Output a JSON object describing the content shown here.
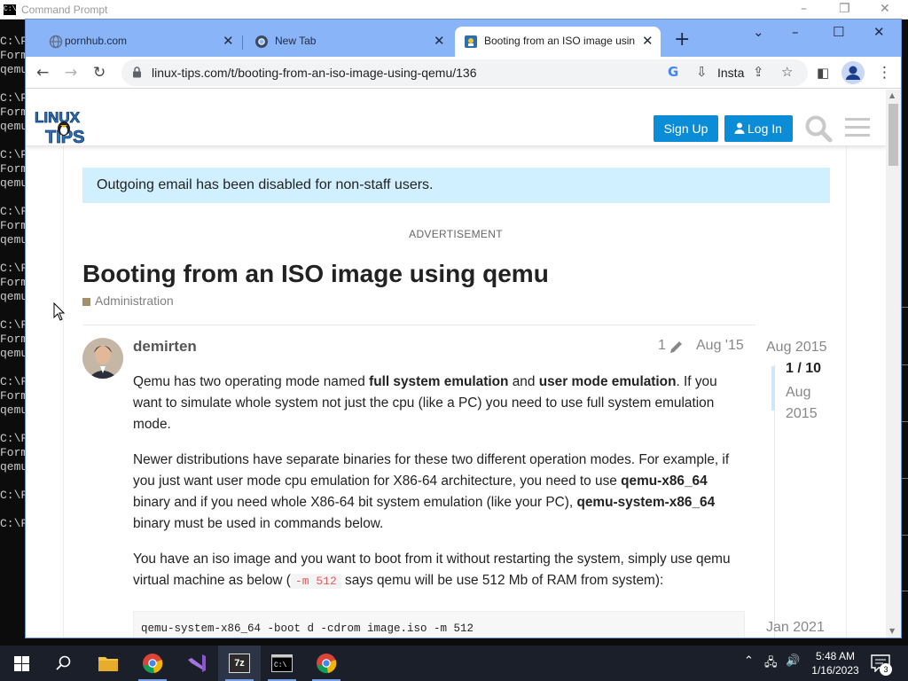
{
  "cmd": {
    "title": "Command Prompt",
    "lines": [
      "C:\\P",
      "Form",
      "qemu",
      "",
      "C:\\P",
      "Form",
      "qemu",
      "",
      "C:\\P",
      "Form",
      "qemu",
      "",
      "C:\\F",
      "Form",
      "qemu",
      "",
      "C:\\F",
      "Form",
      "qemu",
      "",
      "C:\\F",
      "Form",
      "qemu",
      "",
      "C:\\F",
      "Form",
      "qemu",
      "",
      "C:\\F",
      "Form",
      "qemu",
      "",
      "C:\\F",
      "",
      "C:\\F"
    ]
  },
  "browser": {
    "tabs": [
      {
        "title": "pornhub.com",
        "favicon": "globe-icon"
      },
      {
        "title": "New Tab",
        "favicon": "chrome-icon"
      },
      {
        "title": "Booting from an ISO image usin",
        "favicon": "linux-tips-favicon"
      }
    ],
    "url": "linux-tips.com/t/booting-from-an-iso-image-using-qemu/136",
    "install_label": "Insta"
  },
  "site": {
    "signup_label": "Sign Up",
    "login_label": "Log In",
    "logo_text": "LINUX TIPS"
  },
  "page": {
    "alert": "Outgoing email has been disabled for non-staff users.",
    "advertisement": "ADVERTISEMENT",
    "title": "Booting from an ISO image using qemu",
    "category": "Administration",
    "category_color": "#a49067",
    "post": {
      "username": "demirten",
      "edit_count": "1",
      "date": "Aug '15",
      "p1_a": "Qemu has two operating mode named ",
      "p1_b": "full system emulation",
      "p1_c": " and ",
      "p1_d": "user mode emulation",
      "p1_e": ". If you want to simulate whole system not just the cpu (like a PC) you need to use full system emulation mode.",
      "p2_a": "Newer distributions have separate binaries for these two different operation modes. For example, if you just want user mode cpu emulation for X86-64 architecture, you need to use ",
      "p2_b": "qemu-x86_64",
      "p2_c": " binary and if you need whole X86-64 bit system emulation (like your PC), ",
      "p2_d": "qemu-system-x86_64",
      "p2_e": " binary must be used in commands below.",
      "p3_a": "You have an iso image and you want to boot from it without restarting the system, simply use qemu virtual machine as below (",
      "p3_code": "-m 512",
      "p3_b": " says qemu will be use 512 Mb of RAM from system):",
      "code": "qemu-system-x86_64 -boot d -cdrom image.iso -m 512"
    },
    "timeline": {
      "start": "Aug 2015",
      "position": "1 / 10",
      "current_date": "Aug 2015",
      "end": "Jan 2021"
    }
  },
  "taskbar": {
    "time": "5:48 AM",
    "date": "1/16/2023",
    "notifications": "3",
    "apps": [
      "start",
      "search",
      "file-explorer",
      "chrome",
      "visual-studio",
      "7zip",
      "command-prompt",
      "chrome-canary"
    ],
    "accent": "#78a0e6"
  }
}
